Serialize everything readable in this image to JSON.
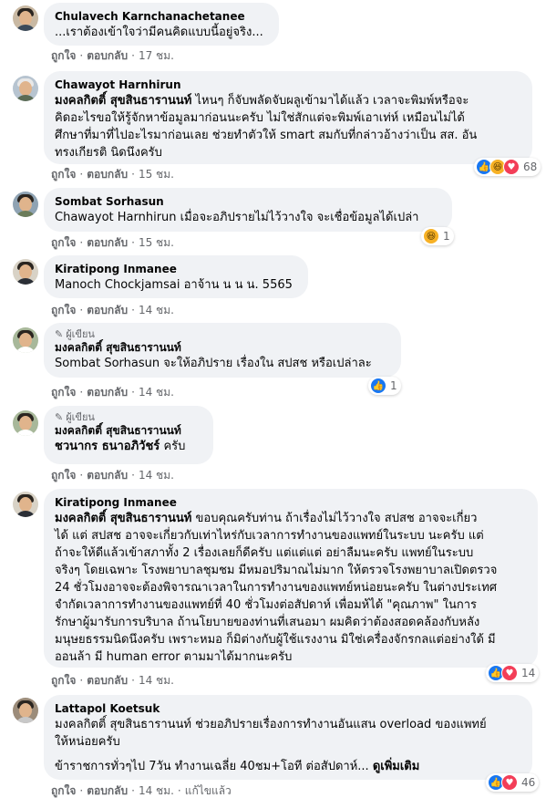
{
  "labels": {
    "like": "ถูกใจ",
    "reply": "ตอบกลับ",
    "edited": "แก้ไขแล้ว",
    "author": "ผู้เขียน",
    "see_more": "ดูเพิ่มเติม"
  },
  "comments": [
    {
      "name": "Chulavech Karnchanachetanee",
      "lines": [
        "...เราต้องเข้าใจว่ามีคนคิดแบบนี้อยู่จริง..."
      ],
      "time": "17 ชม."
    },
    {
      "name": "Chawayot Harnhirun",
      "tag": "มงคลกิตติ์ สุขสินธารานนท์",
      "lines": [
        "ไหนๆ ก็จับพลัดจับผลูเข้ามาได้แล้ว เวลาจะพิมพ์หรือจะ",
        "คิดอะไรขอให้รู้จักหาข้อมูลมาก่อนนะครับ ไม่ใช่สักแต่จะพิมพ์เอาเท่ห์ เหมือนไม่ได้",
        "ศึกษาที่มาที่ไปอะไรมาก่อนเลย ช่วยทำตัวให้ smart สมกับที่กล่าวอ้างว่าเป็น สส. อัน",
        "ทรงเกียรติ นิดนึงครับ"
      ],
      "time": "15 ชม.",
      "reaction_count": "68"
    },
    {
      "name": "Sombat Sorhasun",
      "tag": "Chawayot Harnhirun",
      "lines": [
        "เมื่อจะอภิปรายไม่ไว้วางใจ จะเชื่อข้อมูลได้เปล่า"
      ],
      "time": "15 ชม.",
      "reaction_count": "1"
    },
    {
      "name": "Kiratipong Inmanee",
      "tag": "Manoch Chockjamsai",
      "lines": [
        "อาจ้าน น น น. 5565"
      ],
      "time": "14 ชม."
    },
    {
      "name": "มงคลกิตติ์ สุขสินธารานนท์",
      "tag": "Sombat Sorhasun",
      "lines": [
        "จะให้อภิปราย เรื่องใน สปสช หรือเปล่าละ"
      ],
      "time": "14 ชม.",
      "reaction_count": "1"
    },
    {
      "name": "มงคลกิตติ์ สุขสินธารานนท์",
      "tag": "ชวนากร ธนาอภิวัชร์",
      "lines": [
        "ครับ"
      ],
      "time": "14 ชม."
    },
    {
      "name": "Kiratipong Inmanee",
      "tag": "มงคลกิตติ์ สุขสินธารานนท์",
      "lines": [
        "ขอบคุณครับท่าน ถ้าเรื่องไม่ไว้วางใจ สปสช อาจจะเกี่ยว",
        "ได้ แต่ สปสช อาจจะเกี่ยวกับเท่าไหร่กับเวลาการทำงานของแพทย์ในระบบ นะครับ แต่",
        "ถ้าจะให้ดีแล้วเข้าสภาทั้ง 2 เรื่องเลยก็ดีครับ แต่แต่แต่ อย่าลืมนะครับ แพทย์ในระบบ",
        "จริงๆ โดยเฉพาะ โรงพยาบาลชุมชม มีหมอปริมาณไม่มาก ให้ตรวจโรงพยาบาลเปิดตรวจ",
        "24 ชั่วโมงอาจจะต้องพิจารณาเวลาในการทำงานของแพทย์หน่อยนะครับ ในต่างประเทศ",
        "จำกัดเวลาการทำงานของแพทย์ที่ 40 ชั่วโมงต่อสัปดาห์ เพื่อมห้ได้ \"คุณภาพ\" ในการ",
        "รักษาผู้มารับการบริบาล ถ้านโยบายของท่านที่เสนอมา ผมคิดว่าต้องสอดคล้องกับหลัง",
        "มนุษยธรรมนิดนึงครับ เพราะหมอ ก็มิต่างกับผู้ใช้แรงงาน มิใช่เครื่องจักรกลแต่อย่างใด้ มี",
        "ออนล้า มี human error ตามมาได้มากนะครับ"
      ],
      "time": "14 ชม.",
      "reaction_count": "14"
    },
    {
      "name": "Lattapol Koetsuk",
      "lines": [
        "มงคลกิตติ์ สุขสินธารานนท์ ช่วยอภิปรายเรื่องการทำงานอันแสน overload ของแพทย์",
        "ให้หน่อยครับ"
      ],
      "extra": "ข้าราชการทั่วๆไป 7วัน ทำงานเฉลี่ย 40ชม+โอที ต่อสัปดาห์...",
      "time": "14 ชม.",
      "reaction_count": "46"
    }
  ]
}
